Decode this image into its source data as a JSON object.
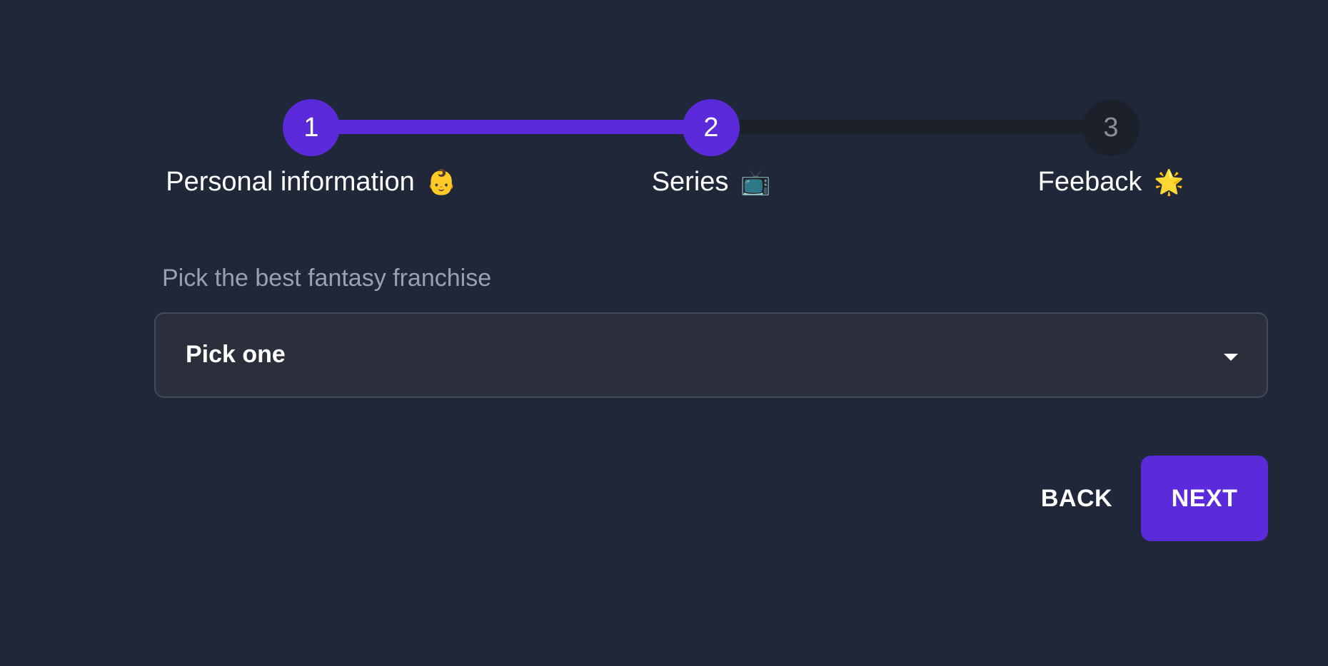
{
  "stepper": {
    "steps": [
      {
        "number": "1",
        "label": "Personal information",
        "emoji": "👶",
        "state": "completed"
      },
      {
        "number": "2",
        "label": "Series",
        "emoji": "📺",
        "state": "active"
      },
      {
        "number": "3",
        "label": "Feeback",
        "emoji": "🌟",
        "state": "upcoming"
      }
    ]
  },
  "form": {
    "label": "Pick the best fantasy franchise",
    "select_value": "Pick one"
  },
  "actions": {
    "back_label": "BACK",
    "next_label": "NEXT"
  },
  "colors": {
    "background": "#1f2739",
    "accent": "#5b2bdb",
    "inactive_step": "#1b202b",
    "select_bg": "#2b2f3b"
  }
}
